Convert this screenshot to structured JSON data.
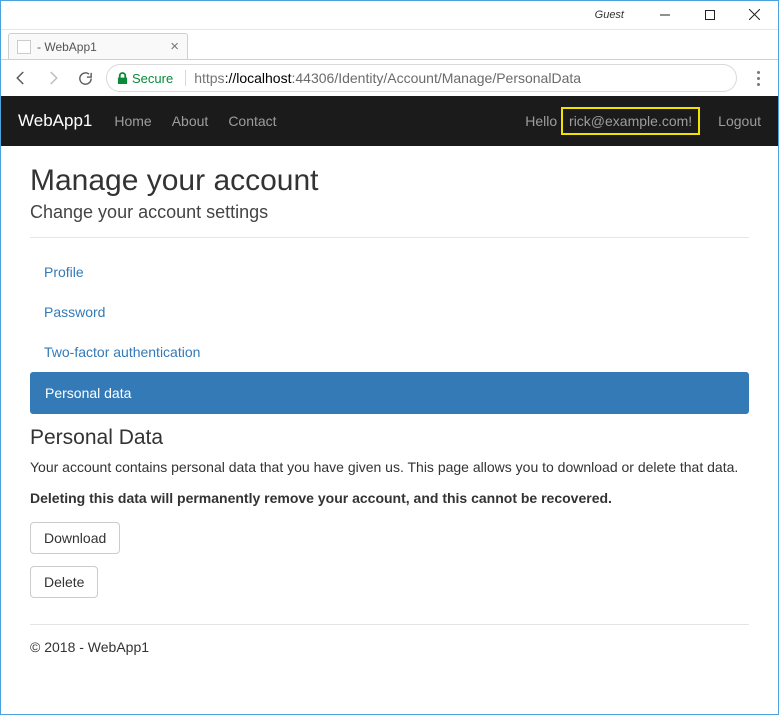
{
  "window": {
    "guest_label": "Guest"
  },
  "tab": {
    "title": "- WebApp1"
  },
  "address": {
    "secure_label": "Secure",
    "proto": "https",
    "host": "://localhost",
    "port": ":44306",
    "path": "/Identity/Account/Manage/PersonalData"
  },
  "nav": {
    "brand": "WebApp1",
    "links": [
      "Home",
      "About",
      "Contact"
    ],
    "hello_prefix": "Hello ",
    "user_email": "rick@example.com!",
    "logout": "Logout"
  },
  "content": {
    "title": "Manage your account",
    "subtitle": "Change your account settings",
    "menu": {
      "items": [
        "Profile",
        "Password",
        "Two-factor authentication",
        "Personal data"
      ],
      "active_index": 3
    },
    "section_heading": "Personal Data",
    "body_text": "Your account contains personal data that you have given us. This page allows you to download or delete that data.",
    "warning_text": "Deleting this data will permanently remove your account, and this cannot be recovered.",
    "download_label": "Download",
    "delete_label": "Delete"
  },
  "footer": {
    "text": "© 2018 - WebApp1"
  }
}
